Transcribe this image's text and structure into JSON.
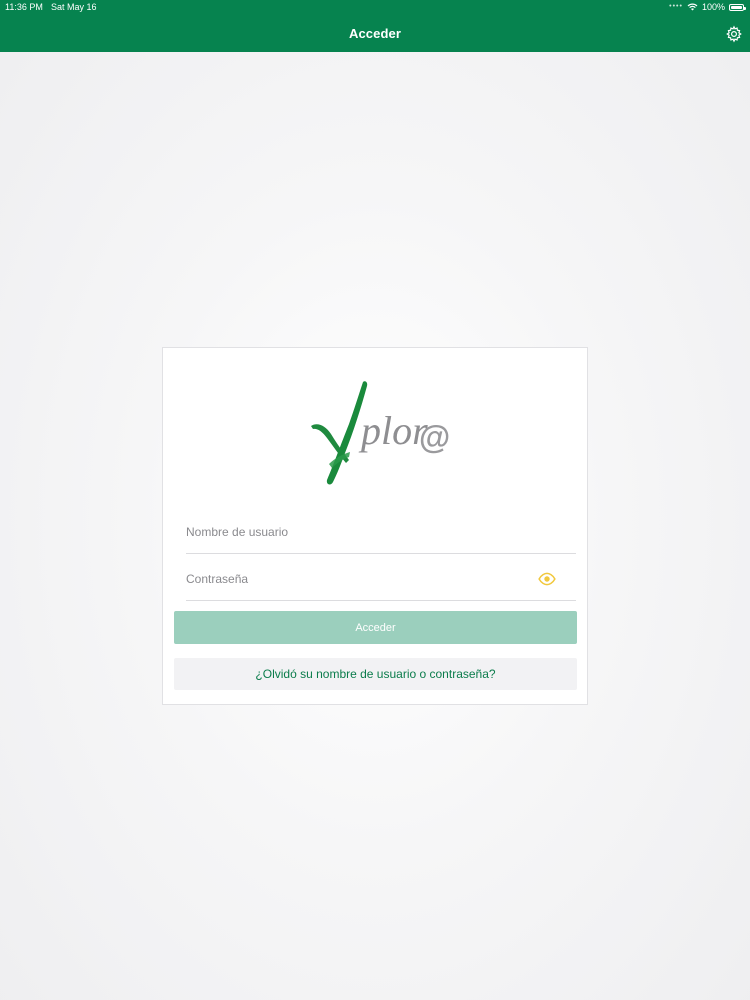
{
  "statusbar": {
    "time": "11:36 PM",
    "date": "Sat May 16",
    "battery": "100%",
    "wifi_icon": "wifi-icon",
    "battery_icon": "battery-icon"
  },
  "navbar": {
    "title": "Acceder",
    "settings_icon": "gear-icon"
  },
  "login": {
    "logo_text": "Xplor@",
    "username_placeholder": "Nombre de usuario",
    "password_placeholder": "Contraseña",
    "show_password_icon": "eye-icon",
    "submit_label": "Acceder",
    "forgot_label": "¿Olvidó su nombre de usuario o contraseña?"
  },
  "colors": {
    "brand": "#06834f",
    "button_disabled": "#9bcfbd",
    "eye_icon": "#f1c83d",
    "link": "#0b7c4b"
  }
}
